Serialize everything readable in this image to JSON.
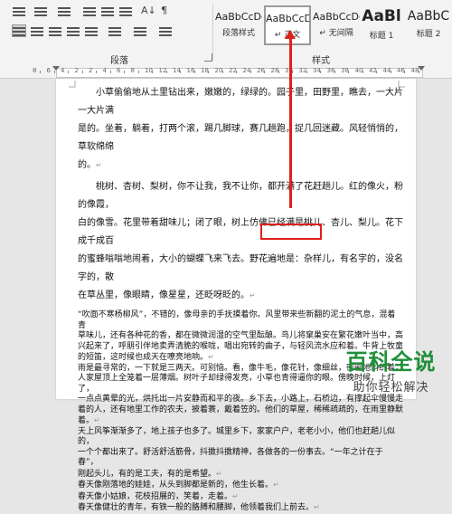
{
  "ribbon": {
    "paragraph_group_label": "段落",
    "styles_group_label": "样式",
    "sort_glyph": "A↓",
    "pilcrow_glyph": "¶",
    "style_items": [
      {
        "preview": "AaBbCcDc",
        "name": "段落样式",
        "selected": false
      },
      {
        "preview": "AaBbCcDc",
        "name": "↵ 正文",
        "selected": true
      },
      {
        "preview": "AaBbCcDc",
        "name": "↵ 无间隔",
        "selected": false
      },
      {
        "preview": "AaBl",
        "name": "标题 1",
        "selected": false
      },
      {
        "preview": "AaBbC",
        "name": "标题 2",
        "selected": false
      }
    ]
  },
  "ruler": {
    "numbers": [
      "8",
      "6",
      "4",
      "2",
      "2",
      "4",
      "6",
      "8",
      "10",
      "12",
      "14",
      "16",
      "18",
      "20",
      "22",
      "24",
      "26",
      "28",
      "30",
      "32",
      "34",
      "36",
      "38",
      "40",
      "42",
      "44",
      "46",
      "48"
    ]
  },
  "document": {
    "paragraph_mark": "↵",
    "loose": [
      {
        "lines": [
          "小草偷偷地从土里钻出来，嫩嫩的，绿绿的。园子里，田野里，瞧去，一大片一大片满",
          "是的。坐着，躺着，打两个滚，踢几脚球，赛几趟跑，捉几回迷藏。风轻悄悄的，草软绵绵",
          "的。"
        ]
      },
      {
        "lines": [
          "桃树、杏树、梨树，你不让我，我不让你，都开满了花赶趟儿。红的像火，粉的像霞，",
          "白的像雪。花里带着甜味儿；闭了眼，树上仿佛已经满是桃儿、杏儿、梨儿。花下成千成百",
          "的蜜蜂嗡嗡地闹着，大小的蝴蝶飞来飞去。野花遍地是：杂样儿，有名字的，没名字的，散",
          "在草丛里，像眼睛，像星星，还眨呀眨的。"
        ]
      }
    ],
    "tight": [
      "“吹面不寒杨柳风”，不错的，像母亲的手抚摸着你。风里带来些新翻的泥土的气息，混着青",
      "草味儿，还有各种花的香，都在微微润湿的空气里酝酿。鸟儿将窠巢安在繁花嫩叶当中，高",
      "兴起来了，呼朋引伴地卖弄清脆的喉咙，唱出宛转的曲子，与轻风流水应和着。牛背上牧童",
      "的短笛，这时候也成天在嘹亮地响。",
      "雨是最寻常的，一下就是三两天。可别恼。看，像牛毛，像花针，像细丝，密密地斜织着，",
      "人家屋顶上全笼着一层薄烟。树叶子却绿得发亮，小草也青得逼你的眼。傍晚时候，上灯了，",
      "一点点黄晕的光，烘托出一片安静而和平的夜。乡下去，小路上，石桥边，有撑起伞慢慢走",
      "着的人，还有地里工作的农夫，披着蓑，戴着笠的。他们的草屋，稀稀疏疏的，在雨里静默",
      "着。",
      "天上风筝渐渐多了，地上孩子也多了。城里乡下，家家户户，老老小小，他们也赶趟儿似的，",
      "一个个都出来了。舒活舒活筋骨，抖擞抖擞精神，各做各的一份事去。“一年之计在于春”，",
      "刚起头儿，有的是工夫，有的是希望。",
      "春天像刚落地的娃娃，从头到脚都是新的，他生长着。",
      "春天像小姑娘，花枝招展的，笑着，走着。",
      "春天像健壮的青年，有铁一般的胳膊和腰脚，他领着我们上前去。"
    ]
  },
  "brand": {
    "title": "百科全说",
    "subtitle": "助你轻松解决"
  },
  "colors": {
    "annotation": "#e0201c",
    "brand_green": "#1f8f3a"
  }
}
